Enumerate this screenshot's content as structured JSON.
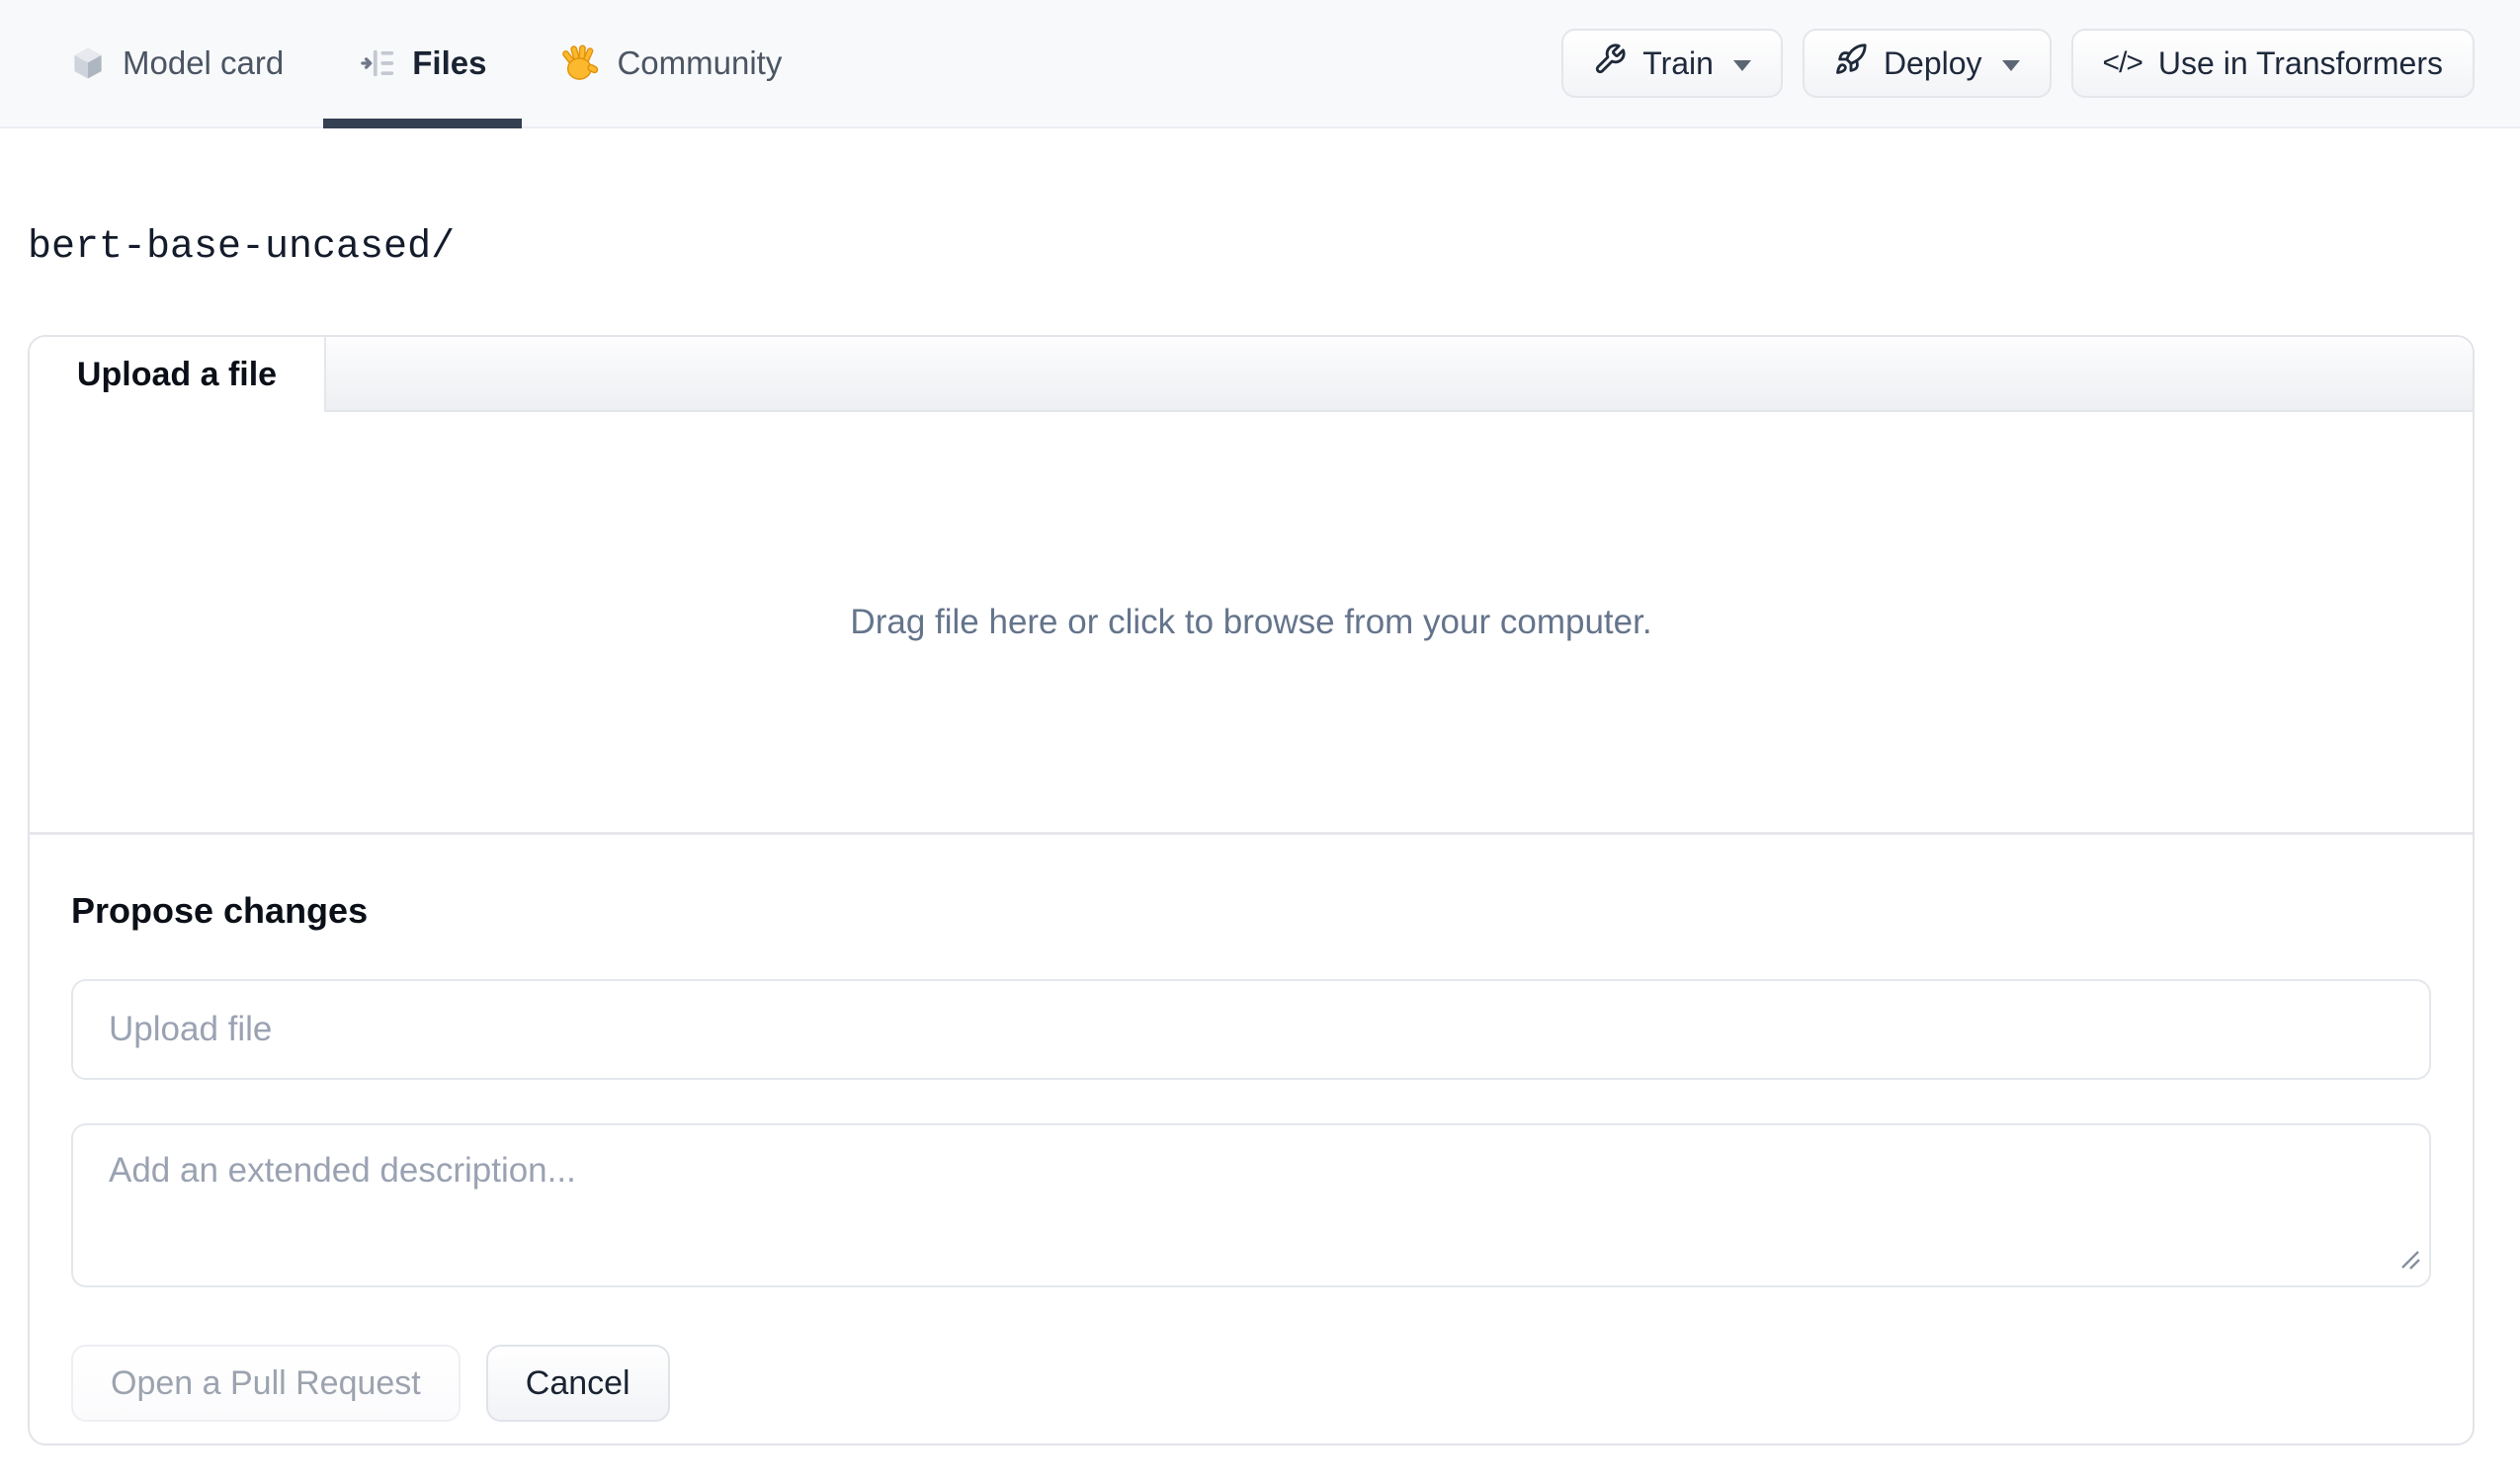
{
  "header": {
    "tabs": [
      {
        "label": "Model card",
        "icon": "cube-icon",
        "active": false
      },
      {
        "label": "Files",
        "icon": "files-versions-icon",
        "active": true
      },
      {
        "label": "Community",
        "icon": "waving-hand-icon",
        "active": false
      }
    ],
    "actions": [
      {
        "label": "Train",
        "icon": "wrench-icon",
        "has_dropdown": true
      },
      {
        "label": "Deploy",
        "icon": "rocket-icon",
        "has_dropdown": true
      },
      {
        "label": "Use in Transformers",
        "icon": "code-icon",
        "has_dropdown": false
      }
    ]
  },
  "breadcrumb": {
    "repo_path": "bert-base-uncased/"
  },
  "upload_card": {
    "tab_label": "Upload a file",
    "dropzone_text": "Drag file here or click to browse from your computer.",
    "propose_heading": "Propose changes",
    "file_input_placeholder": "Upload file",
    "description_placeholder": "Add an extended description...",
    "buttons": {
      "open_pr": "Open a Pull Request",
      "cancel": "Cancel"
    }
  },
  "colors": {
    "header_bg": "#f8f9fb",
    "active_tab_underline": "#353f52",
    "tab_text": "#4b5563",
    "active_tab_text": "#1a2332",
    "card_border": "#e2e4e9",
    "muted_text": "#64748b",
    "placeholder_text": "#9aa2b2",
    "disabled_text": "#9ca3af",
    "hand_yellow": "#fdb92e"
  }
}
